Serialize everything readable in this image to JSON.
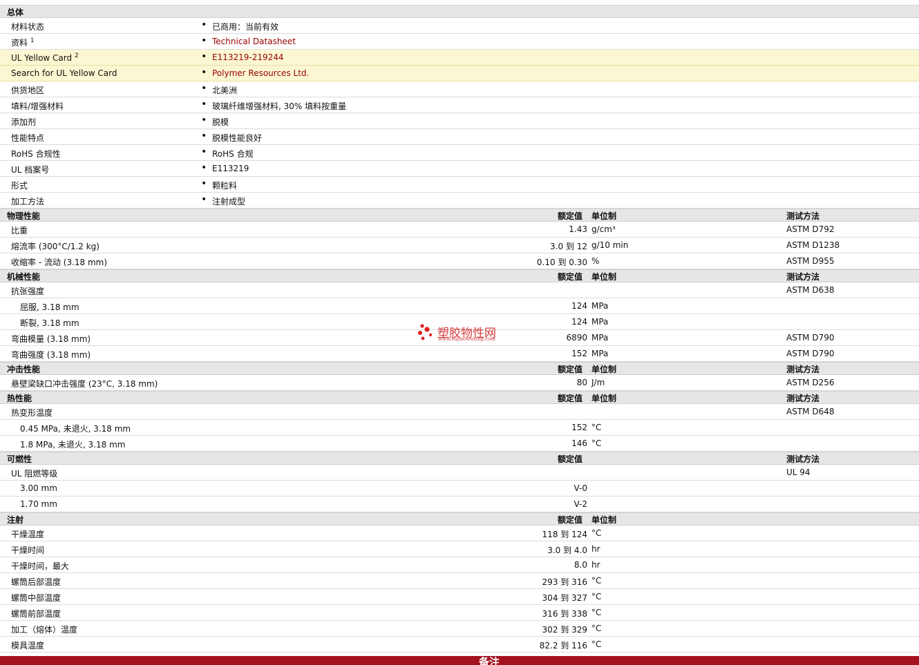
{
  "general": {
    "title": "总体",
    "rows": [
      {
        "label": "材料状态",
        "sup": "",
        "value": "已商用：当前有效",
        "link": false,
        "highlight": false
      },
      {
        "label": "资料",
        "sup": "1",
        "value": "Technical Datasheet",
        "link": true,
        "highlight": false
      },
      {
        "label": "UL Yellow Card",
        "sup": "2",
        "value": "E113219-219244",
        "link": true,
        "highlight": true
      },
      {
        "label": "Search for UL Yellow Card",
        "sup": "",
        "value": "Polymer Resources Ltd.",
        "link": true,
        "highlight": true
      },
      {
        "label": "供货地区",
        "sup": "",
        "value": "北美洲",
        "link": false,
        "highlight": false
      },
      {
        "label": "填料/增强材料",
        "sup": "",
        "value": "玻璃纤维增强材料, 30% 填料按重量",
        "link": false,
        "highlight": false
      },
      {
        "label": "添加剂",
        "sup": "",
        "value": "脱模",
        "link": false,
        "highlight": false
      },
      {
        "label": "性能特点",
        "sup": "",
        "value": "脱模性能良好",
        "link": false,
        "highlight": false
      },
      {
        "label": "RoHS 合规性",
        "sup": "",
        "value": "RoHS 合规",
        "link": false,
        "highlight": false
      },
      {
        "label": "UL 档案号",
        "sup": "",
        "value": "E113219",
        "link": false,
        "highlight": false
      },
      {
        "label": "形式",
        "sup": "",
        "value": "颗粒料",
        "link": false,
        "highlight": false
      },
      {
        "label": "加工方法",
        "sup": "",
        "value": "注射成型",
        "link": false,
        "highlight": false
      }
    ]
  },
  "sections": [
    {
      "title": "物理性能",
      "rated": "额定值",
      "unit": "单位制",
      "test": "测试方法",
      "rows": [
        {
          "label": "比重",
          "num": "1.43",
          "unit": "g/cm³",
          "test": "ASTM D792",
          "sub": false
        },
        {
          "label": "熔流率  (300°C/1.2 kg)",
          "num": "3.0 到   12",
          "unit": "g/10 min",
          "test": "ASTM D1238",
          "sub": false
        },
        {
          "label": "收缩率  - 流动  (3.18 mm)",
          "num": "0.10 到  0.30",
          "unit": "%",
          "test": "ASTM D955",
          "sub": false
        }
      ]
    },
    {
      "title": "机械性能",
      "rated": "额定值",
      "unit": "单位制",
      "test": "测试方法",
      "rows": [
        {
          "label": "抗张强度",
          "num": "",
          "unit": "",
          "test": "ASTM D638",
          "sub": false
        },
        {
          "label": "屈服, 3.18 mm",
          "num": "124",
          "unit": "MPa",
          "test": "",
          "sub": true
        },
        {
          "label": "断裂, 3.18 mm",
          "num": "124",
          "unit": "MPa",
          "test": "",
          "sub": true
        },
        {
          "label": "弯曲模量  (3.18 mm)",
          "num": "6890",
          "unit": "MPa",
          "test": "ASTM D790",
          "sub": false
        },
        {
          "label": "弯曲强度  (3.18 mm)",
          "num": "152",
          "unit": "MPa",
          "test": "ASTM D790",
          "sub": false
        }
      ]
    },
    {
      "title": "冲击性能",
      "rated": "额定值",
      "unit": "单位制",
      "test": "测试方法",
      "rows": [
        {
          "label": "悬壁梁缺口冲击强度  (23°C, 3.18 mm)",
          "num": "80",
          "unit": "J/m",
          "test": "ASTM D256",
          "sub": false
        }
      ]
    },
    {
      "title": "热性能",
      "rated": "额定值",
      "unit": "单位制",
      "test": "测试方法",
      "rows": [
        {
          "label": "热变形温度",
          "num": "",
          "unit": "",
          "test": "ASTM D648",
          "sub": false
        },
        {
          "label": "0.45 MPa, 未退火, 3.18 mm",
          "num": "152",
          "unit": "°C",
          "test": "",
          "sub": true
        },
        {
          "label": "1.8 MPa, 未退火, 3.18 mm",
          "num": "146",
          "unit": "°C",
          "test": "",
          "sub": true
        }
      ]
    },
    {
      "title": "可燃性",
      "rated": "额定值",
      "unit": "",
      "test": "测试方法",
      "rows": [
        {
          "label": "UL 阻燃等级",
          "num": "",
          "unit": "",
          "test": "UL 94",
          "sub": false
        },
        {
          "label": "3.00 mm",
          "num": "V-0",
          "unit": "",
          "test": "",
          "sub": true
        },
        {
          "label": "1.70 mm",
          "num": "V-2",
          "unit": "",
          "test": "",
          "sub": true
        }
      ]
    },
    {
      "title": "注射",
      "rated": "额定值",
      "unit": "单位制",
      "test": "",
      "rows": [
        {
          "label": "干燥温度",
          "num": "118 到   124",
          "unit": "°C",
          "test": "",
          "sub": false
        },
        {
          "label": "干燥时间",
          "num": "3.0 到   4.0",
          "unit": "hr",
          "test": "",
          "sub": false
        },
        {
          "label": "干燥时间，最大",
          "num": "8.0",
          "unit": "hr",
          "test": "",
          "sub": false
        },
        {
          "label": "螺筒后部温度",
          "num": "293 到   316",
          "unit": "°C",
          "test": "",
          "sub": false
        },
        {
          "label": "螺筒中部温度",
          "num": "304 到   327",
          "unit": "°C",
          "test": "",
          "sub": false
        },
        {
          "label": "螺筒前部温度",
          "num": "316 到   338",
          "unit": "°C",
          "test": "",
          "sub": false
        },
        {
          "label": "加工（熔体）温度",
          "num": "302 到   329",
          "unit": "°C",
          "test": "",
          "sub": false
        },
        {
          "label": "模具温度",
          "num": "82.2 到   116",
          "unit": "°C",
          "test": "",
          "sub": false
        }
      ]
    }
  ],
  "footer": {
    "title": "备注"
  },
  "watermark": {
    "brand": "塑胶物性网",
    "url": "www.sujiaowuxing.com",
    "color": "#d43a3a"
  }
}
